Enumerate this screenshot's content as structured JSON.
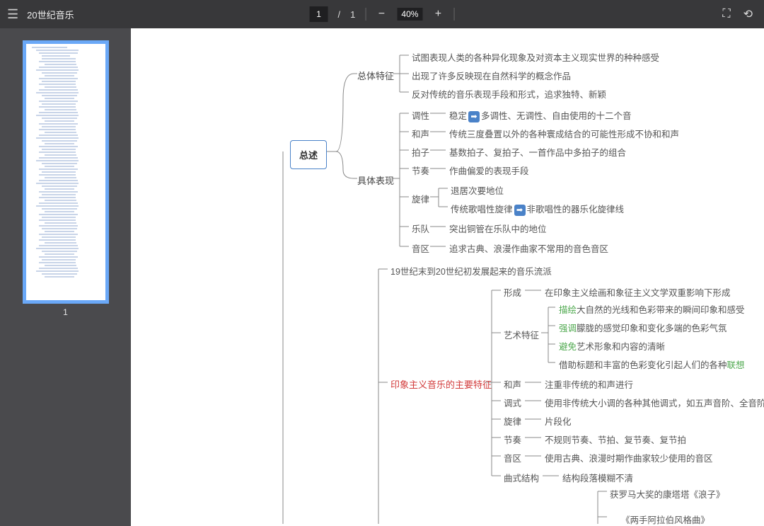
{
  "toolbar": {
    "title": "20世纪音乐",
    "page_current": "1",
    "page_total": "1",
    "zoom_pct": "40%"
  },
  "sidebar": {
    "thumb_num": "1"
  },
  "mindmap": {
    "root": "总述",
    "b1": {
      "label": "总体特征",
      "leaves": [
        "试图表现人类的各种异化现象及对资本主义现实世界的种种感受",
        "出现了许多反映现在自然科学的概念作品",
        "反对传统的音乐表现手段和形式，追求独特、新颖"
      ]
    },
    "b2": {
      "label": "具体表现",
      "items": {
        "tonality": {
          "k": "调性",
          "v_pre": "稳定",
          "v_post": "多调性、无调性、自由使用的十二个音"
        },
        "harmony": {
          "k": "和声",
          "v": "传统三度叠置以外的各种寰成结合的可能性形成不协和和声"
        },
        "meter": {
          "k": "拍子",
          "v": "基数拍子、复拍子、一首作品中多拍子的组合"
        },
        "rhythm": {
          "k": "节奏",
          "v": "作曲偏爱的表现手段"
        },
        "melody": {
          "k": "旋律",
          "sub1": "退居次要地位",
          "sub2_pre": "传统歌唱性旋律",
          "sub2_post": "非歌唱性的器乐化旋律线"
        },
        "orchestra": {
          "k": "乐队",
          "v": "突出铜管在乐队中的地位"
        },
        "register": {
          "k": "音区",
          "v": "追求古典、浪漫作曲家不常用的音色音区"
        }
      }
    },
    "impression": {
      "intro": "19世纪末到20世纪初发展起来的音乐流派",
      "title": "印象主义音乐的主要特征",
      "items": {
        "formation": {
          "k": "形成",
          "v": "在印象主义绘画和象征主义文学双重影响下形成"
        },
        "art": {
          "k": "艺术特征",
          "lines": [
            {
              "kw": "描绘",
              "t": "大自然的光线和色彩带来的瞬间印象和感受"
            },
            {
              "kw": "强调",
              "t": "朦胧的感觉印象和变化多端的色彩气氛"
            },
            {
              "kw": "避免",
              "t": "艺术形象和内容的清晰"
            },
            {
              "t_pre": "借助标题和丰富的色彩变化引起人们的各种",
              "kw_tail": "联想"
            }
          ]
        },
        "harmony": {
          "k": "和声",
          "v": "注重非传统的和声进行"
        },
        "mode": {
          "k": "调式",
          "v": "使用非传统大小调的各种其他调式，如五声音阶、全音阶"
        },
        "melody": {
          "k": "旋律",
          "v": "片段化"
        },
        "rhythm": {
          "k": "节奏",
          "v": "不规则节奏、节拍、复节奏、复节拍"
        },
        "register": {
          "k": "音区",
          "v": "使用古典、浪漫时期作曲家较少使用的音区"
        },
        "form": {
          "k": "曲式结构",
          "v": "结构段落模糊不清"
        }
      },
      "works": {
        "w1": "获罗马大奖的康塔塔《浪子》",
        "w2": "《两手阿拉伯风格曲》"
      }
    }
  }
}
